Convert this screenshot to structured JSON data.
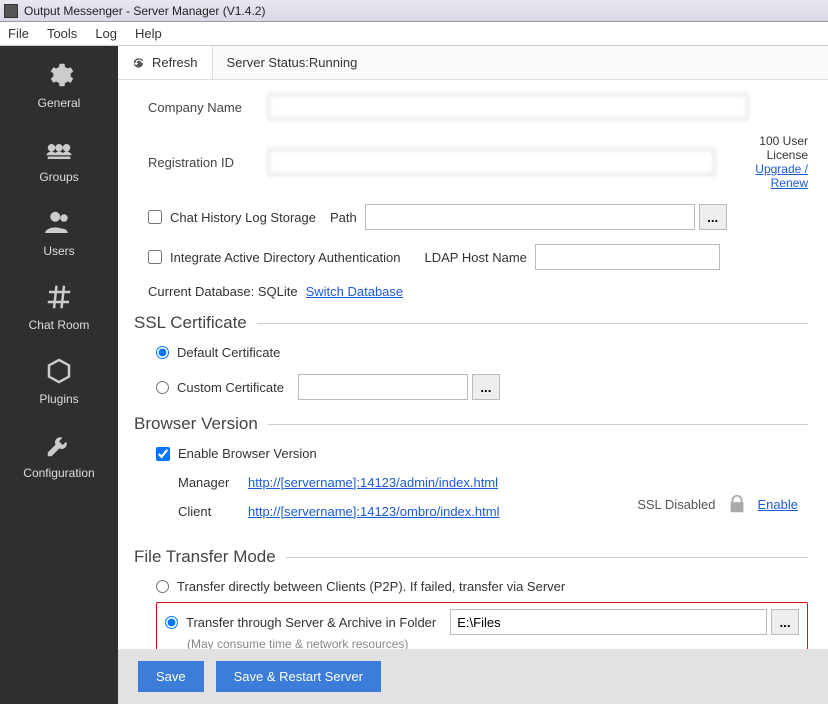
{
  "window": {
    "title": "Output Messenger - Server Manager  (V1.4.2)"
  },
  "menu": {
    "file": "File",
    "tools": "Tools",
    "log": "Log",
    "help": "Help"
  },
  "sidebar": {
    "items": [
      {
        "label": "General"
      },
      {
        "label": "Groups"
      },
      {
        "label": "Users"
      },
      {
        "label": "Chat Room"
      },
      {
        "label": "Plugins"
      },
      {
        "label": "Configuration"
      }
    ]
  },
  "toolbar": {
    "refresh": "Refresh",
    "status_label": "Server Status: ",
    "status_value": "Running"
  },
  "form": {
    "company_label": "Company Name",
    "company_value": "",
    "reg_label": "Registration ID",
    "reg_value": "",
    "license_text": "100 User License",
    "upgrade_link": "Upgrade / Renew",
    "chat_log_label": "Chat History Log Storage",
    "path_label": "Path",
    "adauth_label": "Integrate Active Directory Authentication",
    "ldap_label": "LDAP Host Name",
    "curdb_label": "Current Database: SQLite",
    "switch_db": "Switch Database"
  },
  "ssl": {
    "title": "SSL Certificate",
    "default_label": "Default Certificate",
    "custom_label": "Custom Certificate"
  },
  "browser": {
    "title": "Browser Version",
    "enable_label": "Enable Browser Version",
    "manager_label": "Manager",
    "manager_url": "http://[servername]:14123/admin/index.html",
    "client_label": "Client",
    "client_url": "http://[servername]:14123/ombro/index.html",
    "ssl_disabled": "SSL Disabled",
    "enable_link": "Enable"
  },
  "transfer": {
    "title": "File Transfer Mode",
    "p2p_label": "Transfer directly between Clients (P2P).  If failed, transfer via Server",
    "server_label": "Transfer through Server & Archive in Folder",
    "folder_value": "E:\\Files",
    "note": "(May consume time & network resources)"
  },
  "footer": {
    "save": "Save",
    "save_restart": "Save & Restart Server"
  }
}
